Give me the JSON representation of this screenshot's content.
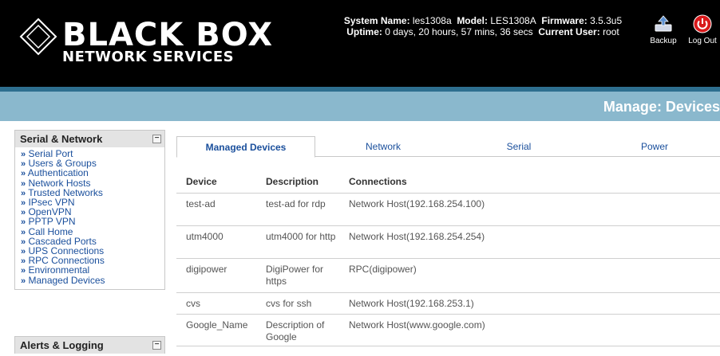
{
  "header": {
    "logo_line1": "BLACK BOX",
    "logo_line2": "NETWORK SERVICES",
    "system_name_label": "System Name:",
    "system_name": "les1308a",
    "model_label": "Model:",
    "model": "LES1308A",
    "firmware_label": "Firmware:",
    "firmware": "3.5.3u5",
    "uptime_label": "Uptime:",
    "uptime": "0 days, 20 hours, 57 mins, 36 secs",
    "current_user_label": "Current User:",
    "current_user": "root",
    "backup_label": "Backup",
    "logout_label": "Log Out"
  },
  "page": {
    "title": "Manage: Devices"
  },
  "sidebar": {
    "sections": [
      {
        "title": "Serial & Network",
        "items": [
          "Serial Port",
          "Users & Groups",
          "Authentication",
          "Network Hosts",
          "Trusted Networks",
          "IPsec VPN",
          "OpenVPN",
          "PPTP VPN",
          "Call Home",
          "Cascaded Ports",
          "UPS Connections",
          "RPC Connections",
          "Environmental",
          "Managed Devices"
        ]
      },
      {
        "title": "Alerts & Logging",
        "items": []
      }
    ],
    "bullet": "»",
    "collapse_symbol": "⊟"
  },
  "tabs": [
    "Managed Devices",
    "Network",
    "Serial",
    "Power"
  ],
  "table": {
    "headers": [
      "Device",
      "Description",
      "Connections"
    ],
    "rows": [
      [
        "test-ad",
        "test-ad for rdp",
        "Network Host(192.168.254.100)"
      ],
      [
        "utm4000",
        "utm4000 for http",
        "Network Host(192.168.254.254)"
      ],
      [
        "digipower",
        "DigiPower for https",
        "RPC(digipower)"
      ],
      [
        "cvs",
        "cvs for ssh",
        "Network Host(192.168.253.1)"
      ],
      [
        "Google_Name",
        "Description of Google",
        "Network Host(www.google.com)"
      ]
    ]
  },
  "colors": {
    "header_bg": "#000000",
    "strip": "#8ab8cd",
    "link": "#1a4f9c"
  }
}
